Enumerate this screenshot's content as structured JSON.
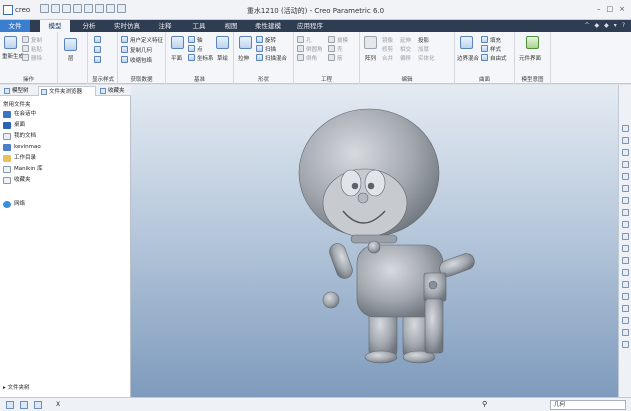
{
  "app": {
    "logo_text": "creo",
    "title": "重水1210 (活动的) - Creo Parametric 6.0",
    "win_controls": [
      "–",
      "□",
      "×"
    ]
  },
  "tabs": [
    "文件",
    "模型",
    "分析",
    "实时仿真",
    "注释",
    "工具",
    "视图",
    "柔性建模",
    "应用程序"
  ],
  "tab_controls": [
    "^",
    "◆",
    "◆",
    "▾",
    "?"
  ],
  "ribbon": {
    "groups": [
      "操作",
      "获取数据",
      "基准",
      "形状",
      "工程",
      "编辑",
      "曲面",
      "模型意图"
    ],
    "ops": [
      "重新生成",
      "复制",
      "粘贴",
      "删除"
    ],
    "misc": [
      "层",
      "显示样式"
    ],
    "data": [
      "用户定义特征",
      "复制几何",
      "收缩包络"
    ],
    "datum": [
      "平面",
      "轴",
      "点",
      "坐标系",
      "草绘"
    ],
    "shape": [
      "拉伸",
      "旋转",
      "扫描",
      "扫描混合"
    ],
    "engineering": [
      "孔",
      "倒圆角",
      "倒角",
      "拔模",
      "壳",
      "筋"
    ],
    "edit": [
      "阵列",
      "镜像",
      "修剪",
      "合并",
      "延伸",
      "相交",
      "投影",
      "偏移",
      "加厚",
      "实体化"
    ],
    "surface": [
      "边界混合",
      "填充",
      "样式",
      "自由式"
    ],
    "intent": [
      "元件界面"
    ]
  },
  "left_tabs": [
    "模型树",
    "文件夹浏览器",
    "收藏夹"
  ],
  "folders": {
    "heading": "常用文件夹",
    "items": [
      "在会话中",
      "桌面",
      "我的文档",
      "kevinmao",
      "工作目录",
      "Manikin 库",
      "收藏夹"
    ],
    "network": "网络",
    "footer": "▸ 文件夹树"
  },
  "status": {
    "message": "X",
    "filter": "几何"
  },
  "icons": [
    "regenerate-icon",
    "copy-icon",
    "paste-icon",
    "delete-icon",
    "plane-icon",
    "axis-icon",
    "point-icon",
    "sketch-icon",
    "extrude-icon",
    "revolve-icon",
    "sweep-icon",
    "pattern-icon",
    "mirror-icon",
    "fill-icon",
    "search-icon"
  ],
  "colors": {
    "file_tab": "#3a7fcf",
    "tab_bar": "#2f3d52",
    "viewport_top": "#e4ebf2",
    "viewport_bottom": "#7e9bbd",
    "model": "#a9adb3"
  }
}
